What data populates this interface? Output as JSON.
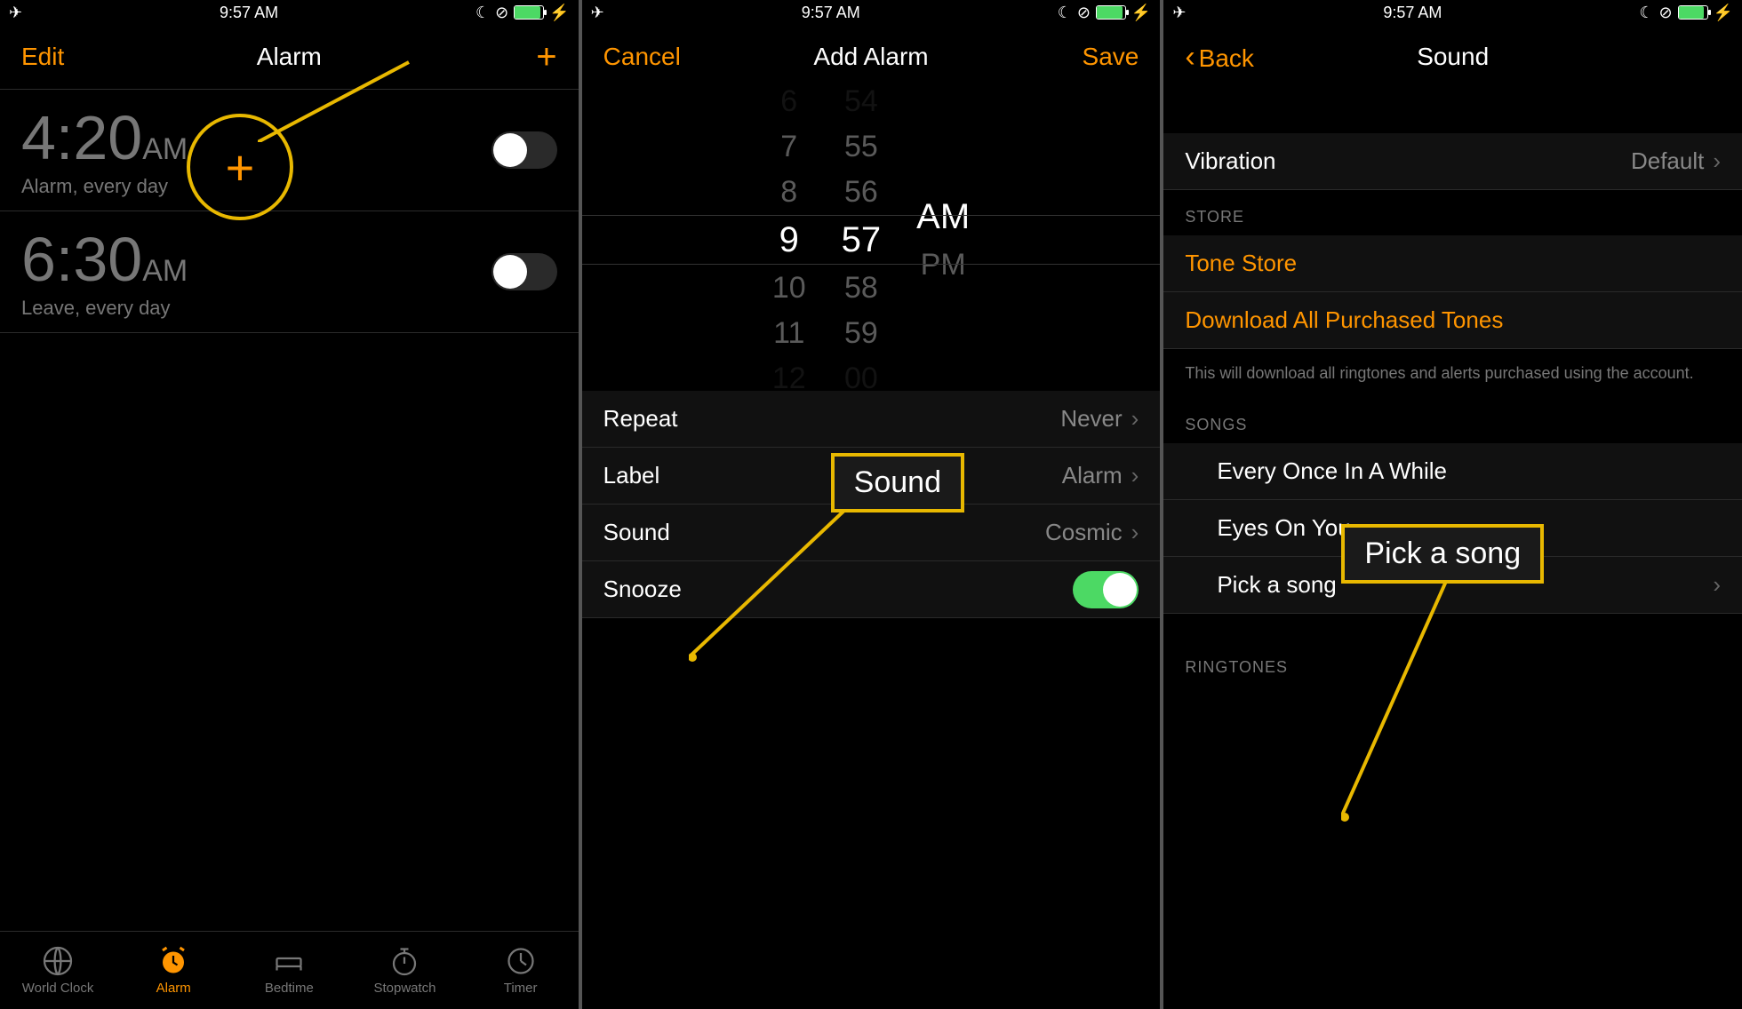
{
  "statusbar": {
    "time": "9:57 AM"
  },
  "screen1": {
    "nav": {
      "left": "Edit",
      "title": "Alarm",
      "plus": "+"
    },
    "alarms": [
      {
        "time": "4:20",
        "ampm": "AM",
        "sub": "Alarm, every day",
        "on": false
      },
      {
        "time": "6:30",
        "ampm": "AM",
        "sub": "Leave, every day",
        "on": false
      }
    ],
    "tabs": [
      "World Clock",
      "Alarm",
      "Bedtime",
      "Stopwatch",
      "Timer"
    ],
    "callout_plus": "+"
  },
  "screen2": {
    "nav": {
      "left": "Cancel",
      "title": "Add Alarm",
      "right": "Save"
    },
    "picker": {
      "hours": [
        "6",
        "7",
        "8",
        "9",
        "10",
        "11",
        "12"
      ],
      "mins": [
        "54",
        "55",
        "56",
        "57",
        "58",
        "59",
        "00"
      ],
      "ampm": [
        "AM",
        "PM"
      ]
    },
    "rows": {
      "repeat": {
        "label": "Repeat",
        "val": "Never"
      },
      "label": {
        "label": "Label",
        "val": "Alarm"
      },
      "sound": {
        "label": "Sound",
        "val": "Cosmic"
      },
      "snooze": {
        "label": "Snooze"
      }
    },
    "callout": "Sound"
  },
  "screen3": {
    "nav": {
      "back": "Back",
      "title": "Sound"
    },
    "vibration": {
      "label": "Vibration",
      "val": "Default"
    },
    "store_header": "STORE",
    "tone_store": "Tone Store",
    "download": "Download All Purchased Tones",
    "footer": "This will download all ringtones and alerts purchased using the account.",
    "songs_header": "SONGS",
    "songs": [
      "Every Once In A While",
      "Eyes On You",
      "Pick a song"
    ],
    "ringtones_header": "RINGTONES",
    "callout": "Pick a song"
  }
}
